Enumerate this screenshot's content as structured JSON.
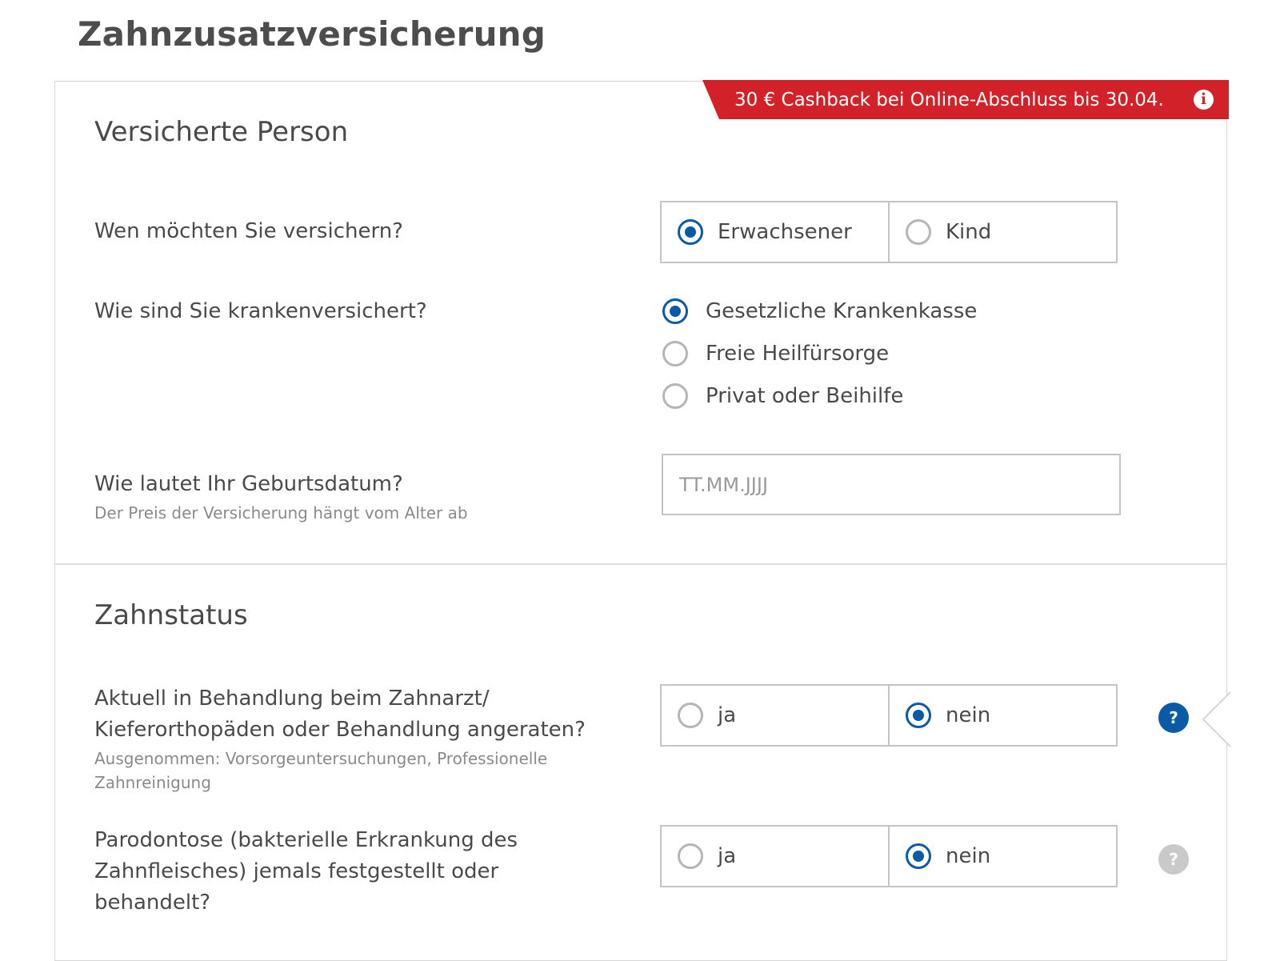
{
  "page": {
    "title": "Zahnzusatzversicherung"
  },
  "promo": {
    "text": "30 € Cashback bei Online-Abschluss bis 30.04.",
    "icon": "info-icon"
  },
  "sections": {
    "person": {
      "title": "Versicherte Person",
      "who": {
        "question": "Wen möchten Sie versichern?",
        "options": [
          {
            "label": "Erwachsener",
            "selected": true
          },
          {
            "label": "Kind",
            "selected": false
          }
        ]
      },
      "insurance": {
        "question": "Wie sind Sie krankenversichert?",
        "options": [
          {
            "label": "Gesetzliche Krankenkasse",
            "selected": true
          },
          {
            "label": "Freie Heilfürsorge",
            "selected": false
          },
          {
            "label": "Privat oder Beihilfe",
            "selected": false
          }
        ]
      },
      "birthdate": {
        "question": "Wie lautet Ihr Geburtsdatum?",
        "hint": "Der Preis der Versicherung hängt vom Alter ab",
        "placeholder": "TT.MM.JJJJ",
        "value": ""
      }
    },
    "teeth": {
      "title": "Zahnstatus",
      "treatment": {
        "question_line1": "Aktuell in Behandlung beim Zahnarzt/",
        "question_line2": "Kieferorthopäden oder Behandlung angeraten?",
        "hint_line1": "Ausgenommen: Vorsorgeuntersuchungen, Professionelle",
        "hint_line2": "Zahnreinigung",
        "options": [
          {
            "label": "ja",
            "selected": false
          },
          {
            "label": "nein",
            "selected": true
          }
        ],
        "help": "?"
      },
      "periodontitis": {
        "question_line1": "Parodontose (bakterielle Erkrankung des",
        "question_line2": "Zahnfleisches) jemals festgestellt oder",
        "question_line3": "behandelt?",
        "options": [
          {
            "label": "ja",
            "selected": false
          },
          {
            "label": "nein",
            "selected": true
          }
        ],
        "help": "?"
      }
    }
  },
  "colors": {
    "accent": "#0a5aa5",
    "promo": "#d3212a",
    "border": "#c4c4c4",
    "help_inactive": "#c9c9c9"
  }
}
